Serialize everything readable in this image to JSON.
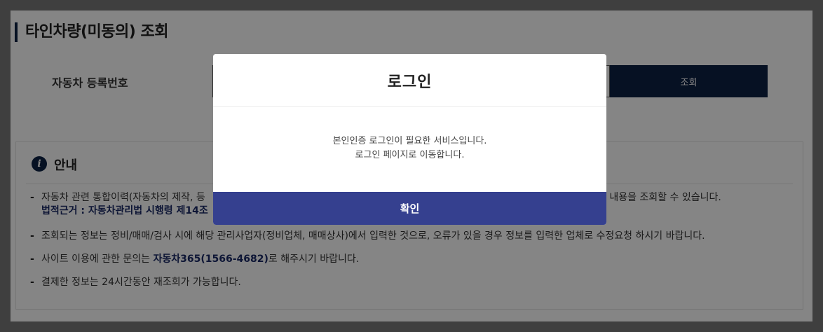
{
  "page": {
    "title": "타인차량(미동의) 조회"
  },
  "search": {
    "label": "자동차 등록번호",
    "input_value": "",
    "button_label": "조회"
  },
  "info": {
    "title": "안내",
    "items": [
      {
        "text": "자동차 관련 통합이력(자동차의 제작, 등",
        "text_right": "된 내용을 조회할 수 있습니다.",
        "sub": "법적근거 : 자동차관리법 시행령 제14조"
      },
      {
        "text": "조회되는 정보는 정비/매매/검사 시에 해당 관리사업자(정비업체, 매매상사)에서 입력한 것으로, 오류가 있을 경우 정보를 입력한 업체로 수정요청 하시기 바랍니다."
      },
      {
        "before": "사이트 이용에 관한 문의는 ",
        "highlight": "자동차365(1566-4682)",
        "after": "로 해주시기 바랍니다."
      },
      {
        "text": "결제한 정보는 24시간동안 재조회가 가능합니다."
      }
    ]
  },
  "modal": {
    "title": "로그인",
    "line1": "본인인증 로그인이 필요한 서비스입니다.",
    "line2": "로그인 페이지로 이동합니다.",
    "confirm_label": "확인"
  },
  "colors": {
    "navy": "#0c2244",
    "confirm": "#35408f",
    "overlay": "rgba(0,0,0,0.48)"
  }
}
